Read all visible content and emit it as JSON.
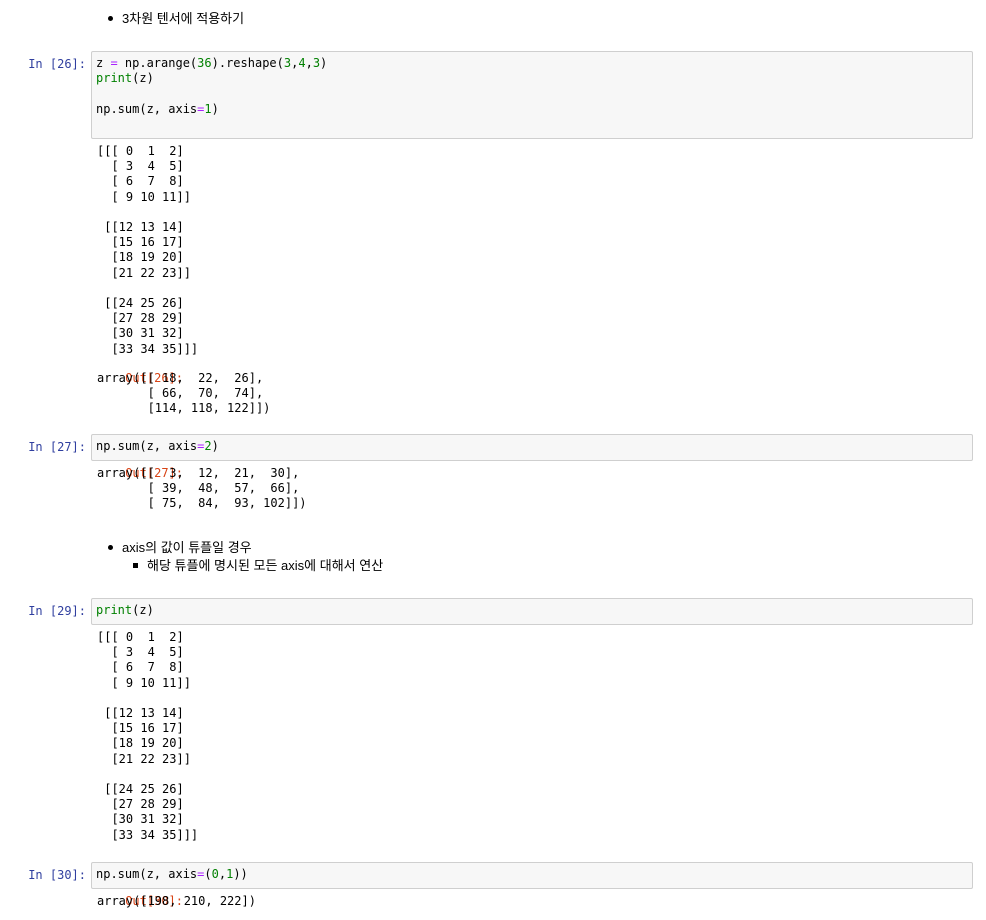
{
  "md1": {
    "bullet": "3차원 텐서에 적용하기"
  },
  "cell26": {
    "in_prompt": "In [26]:",
    "code_lines": [
      "z = np.arange(36).reshape(3,4,3)",
      "print(z)",
      "",
      "np.sum(z, axis=1)"
    ],
    "stdout": "[[[ 0  1  2]\n  [ 3  4  5]\n  [ 6  7  8]\n  [ 9 10 11]]\n\n [[12 13 14]\n  [15 16 17]\n  [18 19 20]\n  [21 22 23]]\n\n [[24 25 26]\n  [27 28 29]\n  [30 31 32]\n  [33 34 35]]]",
    "out_prompt": "Out[26]:",
    "output": "array([[ 18,  22,  26],\n       [ 66,  70,  74],\n       [114, 118, 122]])"
  },
  "cell27": {
    "in_prompt": "In [27]:",
    "code": "np.sum(z, axis=2)",
    "out_prompt": "Out[27]:",
    "output": "array([[  3,  12,  21,  30],\n       [ 39,  48,  57,  66],\n       [ 75,  84,  93, 102]])"
  },
  "md2": {
    "bullet": "axis의 값이 튜플일 경우",
    "sub_bullet": "해당 튜플에 명시된 모든 axis에 대해서 연산"
  },
  "cell29": {
    "in_prompt": "In [29]:",
    "code": "print(z)",
    "stdout": "[[[ 0  1  2]\n  [ 3  4  5]\n  [ 6  7  8]\n  [ 9 10 11]]\n\n [[12 13 14]\n  [15 16 17]\n  [18 19 20]\n  [21 22 23]]\n\n [[24 25 26]\n  [27 28 29]\n  [30 31 32]\n  [33 34 35]]]"
  },
  "cell30": {
    "in_prompt": "In [30]:",
    "code": "np.sum(z, axis=(0,1))",
    "out_prompt": "Out[30]:",
    "output": "array([198, 210, 222])"
  }
}
